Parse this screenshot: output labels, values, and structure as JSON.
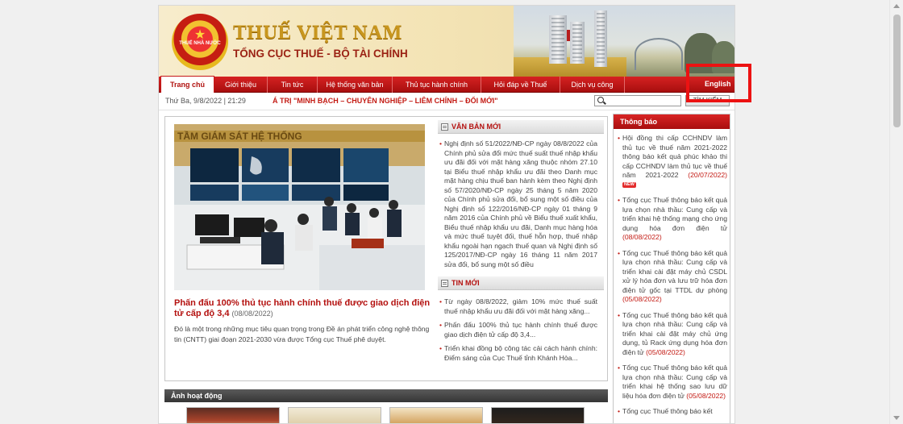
{
  "header": {
    "title": "THUẾ VIỆT NAM",
    "subtitle": "TỔNG CỤC THUẾ - BỘ TÀI CHÍNH",
    "emblem_text": "THUẾ NHÀ NƯỚC"
  },
  "nav": {
    "items": [
      {
        "label": "Trang chủ"
      },
      {
        "label": "Giới thiệu"
      },
      {
        "label": "Tin tức"
      },
      {
        "label": "Hệ thống văn bản"
      },
      {
        "label": "Thủ tục hành chính"
      },
      {
        "label": "Hỏi đáp về Thuế"
      },
      {
        "label": "Dịch vụ công"
      }
    ],
    "english": "English"
  },
  "infobar": {
    "datetime": "Thứ Ba, 9/8/2022 | 21:29",
    "marquee": "Á TRỊ \"MINH BẠCH – CHUYÊN NGHIỆP – LIÊM CHÍNH – ĐỔI MỚI\"",
    "search_button": "TÌM KIẾM"
  },
  "feature": {
    "photo_caption": "TẦM GIÁM SÁT HỆ THỐNG",
    "title": "Phấn đấu 100% thủ tục hành chính thuế được giao dịch điện tử cấp độ 3,4",
    "date": "(08/08/2022)",
    "description": "Đó là một trong những mục tiêu quan trọng trong Đề án phát triển công nghệ thông tin (CNTT) giai đoạn 2021-2030 vừa được Tổng cục Thuế phê duyệt."
  },
  "van_ban_moi": {
    "heading": "VĂN BẢN MỚI",
    "items": [
      "Nghị định số 51/2022/NĐ-CP ngày 08/8/2022 của Chính phủ sửa đổi mức thuế suất thuế nhập khẩu ưu đãi đối với mặt hàng xăng thuộc nhóm 27.10 tại Biểu thuế nhập khẩu ưu đãi theo Danh mục mặt hàng chịu thuế ban hành kèm theo Nghị định số 57/2020/NĐ-CP ngày 25 tháng 5 năm 2020 của Chính phủ sửa đổi, bổ sung một số điều của Nghị định số 122/2016/NĐ-CP ngày 01 tháng 9 năm 2016 của Chính phủ về Biểu thuế xuất khẩu, Biểu thuế nhập khẩu ưu đãi, Danh mục hàng hóa và mức thuế tuyệt đối, thuế hỗn hợp, thuế nhập khẩu ngoài hạn ngạch thuế quan và Nghị định số 125/2017/NĐ-CP ngày 16 tháng 11 năm 2017 sửa đổi, bổ sung một số điều"
    ]
  },
  "tin_moi": {
    "heading": "TIN MỚI",
    "items": [
      "Từ ngày 08/8/2022, giảm 10% mức thuế suất thuế nhập khẩu ưu đãi đối với mặt hàng xăng...",
      "Phấn đấu 100% thủ tục hành chính thuế được giao dịch điện tử cấp độ 3,4...",
      "Triển khai đồng bộ công tác cải cách hành chính: Điểm sáng của Cục Thuế tỉnh Khánh Hòa..."
    ]
  },
  "thong_bao": {
    "heading": "Thông báo",
    "new_badge": "NEW",
    "items": [
      {
        "text": "Hội đồng thi cấp CCHNDV làm thủ tục về thuế năm 2021-2022 thông báo kết quả phúc khảo thi cấp CCHNDV làm thủ tục về thuế năm 2021-2022",
        "date": "(20/07/2022)"
      },
      {
        "text": "Tổng cục Thuế thông báo kết quả lựa chọn nhà thầu: Cung cấp và triển khai hệ thống mạng cho ứng dụng hóa đơn điện tử",
        "date": "(08/08/2022)"
      },
      {
        "text": "Tổng cục Thuế thông báo kết quả lựa chọn nhà thầu: Cung cấp và triển khai cài đặt máy chủ CSDL xử lý hóa đơn và lưu trữ hóa đơn điện tử gốc tại TTDL dự phòng",
        "date": "(05/08/2022)"
      },
      {
        "text": "Tổng cục Thuế thông báo kết quả lựa chọn nhà thầu: Cung cấp và triển khai cài đặt máy chủ ứng dụng, tủ Rack ứng dụng hóa đơn điện tử",
        "date": "(05/08/2022)"
      },
      {
        "text": "Tổng cục Thuế thông báo kết quả lựa chọn nhà thầu: Cung cấp và triển khai hệ thống sao lưu dữ liệu hóa đơn điện tử",
        "date": "(05/08/2022)"
      },
      {
        "text": "Tổng cục Thuế thông báo kết",
        "date": ""
      }
    ]
  },
  "gallery": {
    "heading": "Ảnh hoạt động"
  }
}
